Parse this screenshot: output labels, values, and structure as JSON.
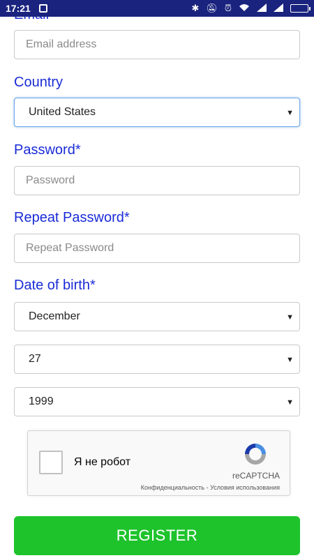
{
  "status_bar": {
    "time": "17:21",
    "icons": [
      "notification-square-icon",
      "bluetooth-icon",
      "mute-icon",
      "alarm-icon",
      "wifi-icon",
      "signal-icon",
      "signal-icon",
      "battery-icon"
    ]
  },
  "form": {
    "email": {
      "label": "Email",
      "placeholder": "Email address"
    },
    "country": {
      "label": "Country",
      "value": "United States"
    },
    "password": {
      "label": "Password*",
      "placeholder": "Password"
    },
    "repeat_password": {
      "label": "Repeat Password*",
      "placeholder": "Repeat Password"
    },
    "dob": {
      "label": "Date of birth*",
      "month": "December",
      "day": "27",
      "year": "1999"
    }
  },
  "captcha": {
    "checkbox_label": "Я не робот",
    "brand": "reCAPTCHA",
    "privacy": "Конфиденциальность",
    "separator": " - ",
    "terms": "Условия использования"
  },
  "register_label": "REGISTER",
  "colors": {
    "status_bar": "#1a237e",
    "label": "#1a2bd6",
    "register_button": "#1ec32c",
    "focus_border": "#6aa7e8"
  }
}
